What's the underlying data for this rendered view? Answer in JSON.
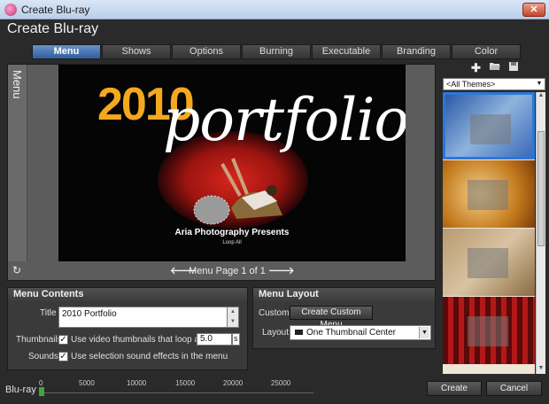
{
  "window": {
    "title": "Create Blu-ray",
    "close_glyph": "✕",
    "icon": "app-icon"
  },
  "header": {
    "title": "Create Blu-ray"
  },
  "tabs": [
    {
      "label": "Menu",
      "active": true
    },
    {
      "label": "Shows"
    },
    {
      "label": "Options"
    },
    {
      "label": "Burning"
    },
    {
      "label": "Executable"
    },
    {
      "label": "Branding"
    },
    {
      "label": "Color"
    }
  ],
  "preview": {
    "side_label": "Menu",
    "menu_year": "2010",
    "menu_word": "portfolio",
    "menu_subtitle": "Aria Photography Presents",
    "menu_loop": "Loop All",
    "page_text": "Menu Page 1 of 1",
    "prev_glyph": "🡐",
    "next_glyph": "🡒",
    "refresh_glyph": "↻"
  },
  "menu_contents": {
    "heading": "Menu Contents",
    "title_label": "Title",
    "title_value": "2010 Portfolio",
    "thumbnails_label": "Thumbnails",
    "thumbnails_text": "Use video thumbnails that loop after",
    "loop_seconds": "5.0",
    "seconds_unit": "s",
    "sounds_label": "Sounds",
    "sounds_text": "Use selection sound effects in the menu",
    "thumbnails_checked": true,
    "sounds_checked": true
  },
  "menu_layout": {
    "heading": "Menu Layout",
    "custom_label": "Custom",
    "custom_button": "Create Custom Menu",
    "layout_label": "Layout",
    "layout_value": "One Thumbnail Center"
  },
  "themes": {
    "filter_value": "<All Themes>",
    "items": [
      {
        "colors": [
          "#2a5aa8",
          "#8fb3de"
        ],
        "selected": true
      },
      {
        "colors": [
          "#c47a1d",
          "#f2d08a"
        ]
      },
      {
        "colors": [
          "#9a7a52",
          "#d8c3a1"
        ]
      },
      {
        "colors": [
          "#5a0a0a",
          "#b21818"
        ]
      }
    ]
  },
  "footer": {
    "disc_label": "Blu-ray",
    "ruler_ticks": [
      "0",
      "5000",
      "10000",
      "15000",
      "20000",
      "25000"
    ],
    "create_button": "Create",
    "cancel_button": "Cancel"
  },
  "colors": {
    "accent": "#2f5e9d",
    "usage": "#3ea83e",
    "year": "#f3a81e"
  }
}
